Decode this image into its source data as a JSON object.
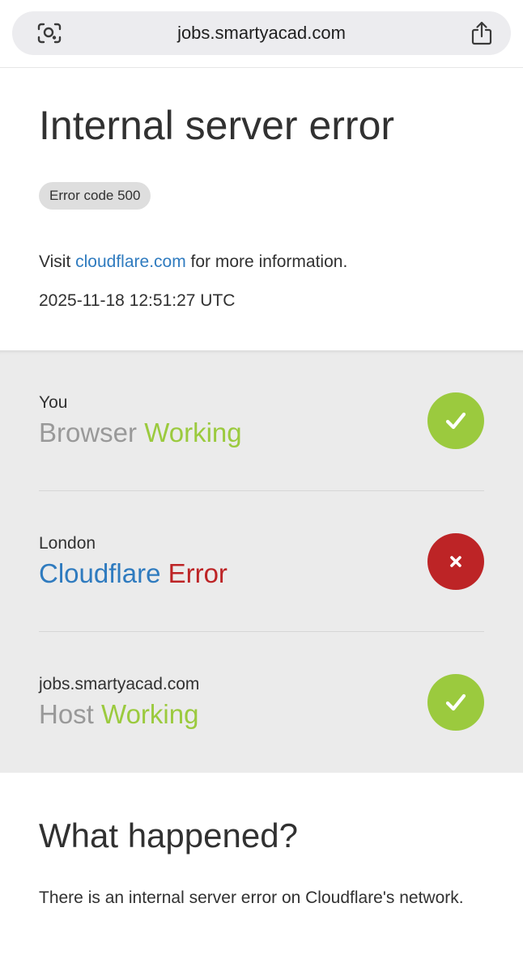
{
  "browser": {
    "url": "jobs.smartyacad.com",
    "lens_icon": "lens-icon",
    "share_icon": "share-icon"
  },
  "header": {
    "title": "Internal server error",
    "error_badge": "Error code 500",
    "visit_prefix": "Visit",
    "visit_link": "cloudflare.com",
    "visit_suffix": "for more information.",
    "timestamp": "2025-11-18 12:51:27 UTC"
  },
  "status": [
    {
      "location": "You",
      "component": "Browser",
      "state": "Working",
      "icon": "checkmark-icon",
      "status_color": "#9bca3e"
    },
    {
      "location": "London",
      "component": "Cloudflare",
      "state": "Error",
      "icon": "cross-icon",
      "status_color": "#bd2426"
    },
    {
      "location": "jobs.smartyacad.com",
      "component": "Host",
      "state": "Working",
      "icon": "checkmark-icon",
      "status_color": "#9bca3e"
    }
  ],
  "what_happened": {
    "heading": "What happened?",
    "body": "There is an internal server error on Cloudflare's network."
  },
  "colors": {
    "link": "#2f7bbf",
    "ok": "#9bca3e",
    "error": "#bd2426",
    "status_bg": "#ebebeb"
  }
}
